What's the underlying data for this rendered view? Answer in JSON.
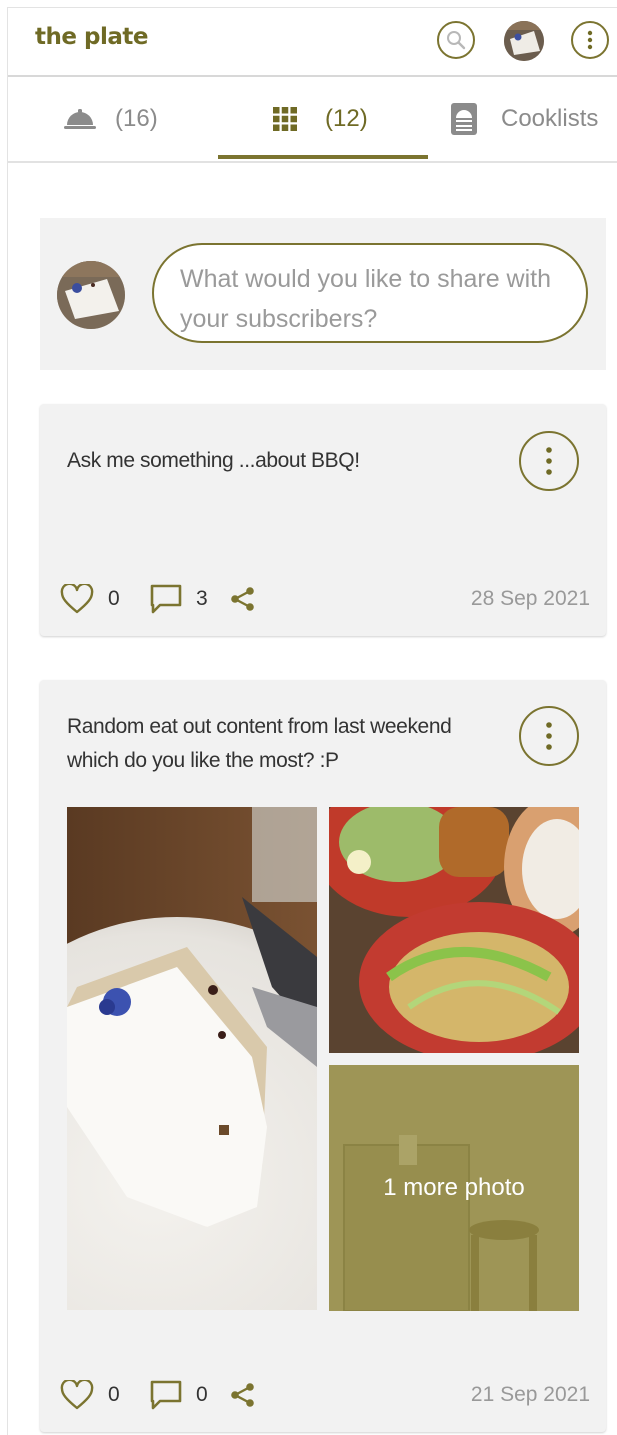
{
  "app": {
    "name": "the plate"
  },
  "colors": {
    "accent": "#7b7430",
    "card_bg": "#f2f2f2",
    "muted": "#8b8b8b"
  },
  "header": {
    "search_icon": "search-icon",
    "avatar": "user-avatar",
    "menu_icon": "vertical-dots-icon"
  },
  "tabs": [
    {
      "icon": "cloche-icon",
      "label": "(16)",
      "active": false
    },
    {
      "icon": "grid-icon",
      "label": "(12)",
      "active": true
    },
    {
      "icon": "cooklist-icon",
      "label": "Cooklists",
      "active": false
    }
  ],
  "composer": {
    "placeholder": "What would you like to share with your subscribers?"
  },
  "posts": [
    {
      "text": "Ask me something ...about BBQ!",
      "likes": "0",
      "comments": "3",
      "date": "28 Sep 2021"
    },
    {
      "text_line1": "Random eat out content from last weekend",
      "text_line2": "which do you like the most? :P",
      "photos": [
        "cake-photo",
        "salad-photo",
        "interior-photo"
      ],
      "more_photos": "1 more photo",
      "likes": "0",
      "comments": "0",
      "date": "21 Sep 2021"
    }
  ]
}
